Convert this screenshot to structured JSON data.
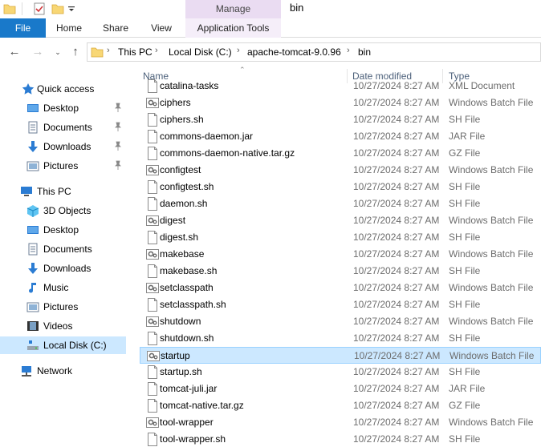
{
  "window": {
    "title": "bin",
    "contextual_tab": "Manage"
  },
  "ribbon": {
    "tabs": [
      {
        "label": "File"
      },
      {
        "label": "Home"
      },
      {
        "label": "Share"
      },
      {
        "label": "View"
      },
      {
        "label": "Application Tools"
      }
    ]
  },
  "address": {
    "breadcrumbs": [
      "This PC",
      "Local Disk (C:)",
      "apache-tomcat-9.0.96",
      "bin"
    ]
  },
  "nav": {
    "items": [
      {
        "label": "Quick access",
        "icon": "star-icon"
      },
      {
        "label": "Desktop",
        "icon": "desktop-icon",
        "pinned": true
      },
      {
        "label": "Documents",
        "icon": "documents-icon",
        "pinned": true
      },
      {
        "label": "Downloads",
        "icon": "download-arrow-icon",
        "pinned": true
      },
      {
        "label": "Pictures",
        "icon": "pictures-icon",
        "pinned": true
      },
      {
        "label": "This PC",
        "icon": "computer-icon"
      },
      {
        "label": "3D Objects",
        "icon": "cube-icon"
      },
      {
        "label": "Desktop",
        "icon": "desktop-icon"
      },
      {
        "label": "Documents",
        "icon": "documents-icon"
      },
      {
        "label": "Downloads",
        "icon": "download-arrow-icon"
      },
      {
        "label": "Music",
        "icon": "music-note-icon"
      },
      {
        "label": "Pictures",
        "icon": "pictures-icon"
      },
      {
        "label": "Videos",
        "icon": "film-icon"
      },
      {
        "label": "Local Disk (C:)",
        "icon": "drive-icon",
        "selected": true
      },
      {
        "label": "Network",
        "icon": "network-icon"
      }
    ]
  },
  "list": {
    "columns": {
      "name": "Name",
      "date": "Date modified",
      "type": "Type"
    },
    "rows": [
      {
        "name": "catalina-tasks",
        "date": "10/27/2024 8:27 AM",
        "type": "XML Document",
        "icon": "doc"
      },
      {
        "name": "ciphers",
        "date": "10/27/2024 8:27 AM",
        "type": "Windows Batch File",
        "icon": "batch"
      },
      {
        "name": "ciphers.sh",
        "date": "10/27/2024 8:27 AM",
        "type": "SH File",
        "icon": "doc"
      },
      {
        "name": "commons-daemon.jar",
        "date": "10/27/2024 8:27 AM",
        "type": "JAR File",
        "icon": "doc"
      },
      {
        "name": "commons-daemon-native.tar.gz",
        "date": "10/27/2024 8:27 AM",
        "type": "GZ File",
        "icon": "doc"
      },
      {
        "name": "configtest",
        "date": "10/27/2024 8:27 AM",
        "type": "Windows Batch File",
        "icon": "batch"
      },
      {
        "name": "configtest.sh",
        "date": "10/27/2024 8:27 AM",
        "type": "SH File",
        "icon": "doc"
      },
      {
        "name": "daemon.sh",
        "date": "10/27/2024 8:27 AM",
        "type": "SH File",
        "icon": "doc"
      },
      {
        "name": "digest",
        "date": "10/27/2024 8:27 AM",
        "type": "Windows Batch File",
        "icon": "batch"
      },
      {
        "name": "digest.sh",
        "date": "10/27/2024 8:27 AM",
        "type": "SH File",
        "icon": "doc"
      },
      {
        "name": "makebase",
        "date": "10/27/2024 8:27 AM",
        "type": "Windows Batch File",
        "icon": "batch"
      },
      {
        "name": "makebase.sh",
        "date": "10/27/2024 8:27 AM",
        "type": "SH File",
        "icon": "doc"
      },
      {
        "name": "setclasspath",
        "date": "10/27/2024 8:27 AM",
        "type": "Windows Batch File",
        "icon": "batch"
      },
      {
        "name": "setclasspath.sh",
        "date": "10/27/2024 8:27 AM",
        "type": "SH File",
        "icon": "doc"
      },
      {
        "name": "shutdown",
        "date": "10/27/2024 8:27 AM",
        "type": "Windows Batch File",
        "icon": "batch"
      },
      {
        "name": "shutdown.sh",
        "date": "10/27/2024 8:27 AM",
        "type": "SH File",
        "icon": "doc"
      },
      {
        "name": "startup",
        "date": "10/27/2024 8:27 AM",
        "type": "Windows Batch File",
        "icon": "batch",
        "selected": true
      },
      {
        "name": "startup.sh",
        "date": "10/27/2024 8:27 AM",
        "type": "SH File",
        "icon": "doc"
      },
      {
        "name": "tomcat-juli.jar",
        "date": "10/27/2024 8:27 AM",
        "type": "JAR File",
        "icon": "doc"
      },
      {
        "name": "tomcat-native.tar.gz",
        "date": "10/27/2024 8:27 AM",
        "type": "GZ File",
        "icon": "doc"
      },
      {
        "name": "tool-wrapper",
        "date": "10/27/2024 8:27 AM",
        "type": "Windows Batch File",
        "icon": "batch"
      },
      {
        "name": "tool-wrapper.sh",
        "date": "10/27/2024 8:27 AM",
        "type": "SH File",
        "icon": "doc"
      }
    ]
  },
  "colors": {
    "accent": "#1979ca",
    "selection": "#cce8ff",
    "manage_tab": "#eadcf2",
    "folder": "#f8d775"
  }
}
